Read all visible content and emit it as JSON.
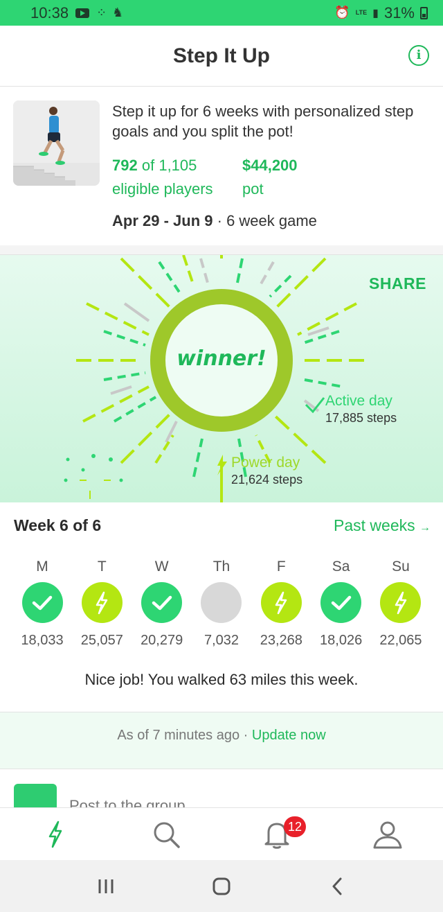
{
  "status_bar": {
    "time": "10:38",
    "battery": "31%",
    "network": "LTE",
    "icons": [
      "youtube-icon",
      "fitbit-icon",
      "notification-icon",
      "alarm-icon",
      "signal-icon",
      "battery-icon"
    ]
  },
  "header": {
    "title": "Step It Up",
    "info_icon": "info-icon"
  },
  "game": {
    "description": "Step it up for 6 weeks with personalized step goals and you split the pot!",
    "players_count": "792",
    "players_of": "of",
    "players_total": "1,105",
    "players_label": "eligible players",
    "pot_amount": "$44,200",
    "pot_label": "pot",
    "dates": "Apr 29 - Jun 9",
    "separator": "·",
    "duration": "6 week game"
  },
  "hero": {
    "share_label": "SHARE",
    "winner_text": "winner!",
    "active_day_label": "Active day",
    "active_day_steps": "17,885 steps",
    "power_day_label": "Power day",
    "power_day_steps": "21,624 steps"
  },
  "week": {
    "title": "Week 6 of 6",
    "past_weeks_label": "Past weeks",
    "days": [
      {
        "label": "M",
        "status": "active",
        "steps": "18,033"
      },
      {
        "label": "T",
        "status": "power",
        "steps": "25,057"
      },
      {
        "label": "W",
        "status": "active",
        "steps": "20,279"
      },
      {
        "label": "Th",
        "status": "none",
        "steps": "7,032"
      },
      {
        "label": "F",
        "status": "power",
        "steps": "23,268"
      },
      {
        "label": "Sa",
        "status": "active",
        "steps": "18,026"
      },
      {
        "label": "Su",
        "status": "power",
        "steps": "22,065"
      }
    ],
    "summary": "Nice job! You walked 63 miles this week."
  },
  "update": {
    "prefix": "As of 7 minutes ago",
    "separator": "·",
    "link": "Update now"
  },
  "post": {
    "placeholder": "Post to the group"
  },
  "bottom_nav": {
    "notifications_badge": "12",
    "items": [
      "bolt-icon",
      "search-icon",
      "bell-icon",
      "profile-icon"
    ]
  },
  "colors": {
    "brand_green": "#1fb85a",
    "active_green": "#2ed573",
    "power_lime": "#b4e612",
    "badge_red": "#e8202a"
  }
}
